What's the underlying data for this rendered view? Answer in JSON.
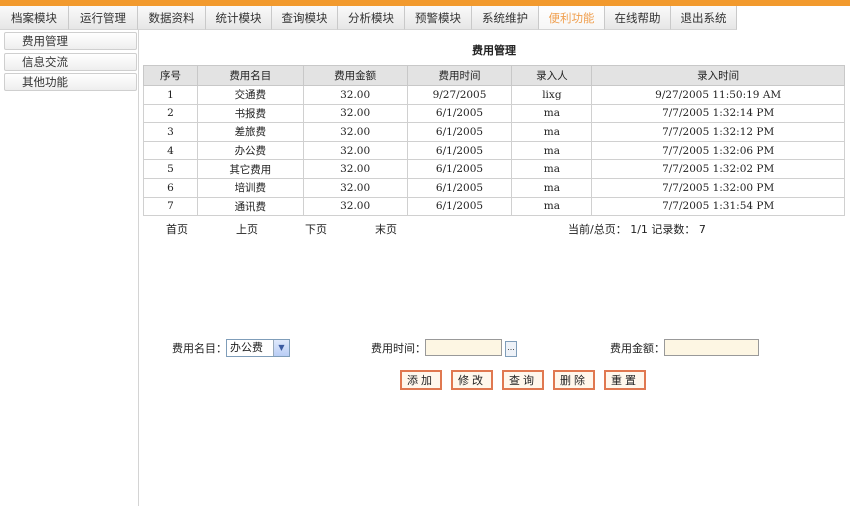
{
  "tabs": [
    "档案模块",
    "运行管理",
    "数据资料",
    "统计模块",
    "查询模块",
    "分析模块",
    "预警模块",
    "系统维护",
    "便利功能",
    "在线帮助",
    "退出系统"
  ],
  "active_tab_index": 8,
  "accent_color": "#f29a2e",
  "sidebar": {
    "items": [
      "费用管理",
      "信息交流",
      "其他功能"
    ]
  },
  "main": {
    "title": "费用管理"
  },
  "table": {
    "headers": [
      "序号",
      "费用名目",
      "费用金额",
      "费用时间",
      "录入人",
      "录入时间"
    ],
    "rows": [
      [
        "1",
        "交通费",
        "32.00",
        "9/27/2005",
        "lixg",
        "9/27/2005 11:50:19 AM"
      ],
      [
        "2",
        "书报费",
        "32.00",
        "6/1/2005",
        "ma",
        "7/7/2005 1:32:14 PM"
      ],
      [
        "3",
        "差旅费",
        "32.00",
        "6/1/2005",
        "ma",
        "7/7/2005 1:32:12 PM"
      ],
      [
        "4",
        "办公费",
        "32.00",
        "6/1/2005",
        "ma",
        "7/7/2005 1:32:06 PM"
      ],
      [
        "5",
        "其它费用",
        "32.00",
        "6/1/2005",
        "ma",
        "7/7/2005 1:32:02 PM"
      ],
      [
        "6",
        "培训费",
        "32.00",
        "6/1/2005",
        "ma",
        "7/7/2005 1:32:00 PM"
      ],
      [
        "7",
        "通讯费",
        "32.00",
        "6/1/2005",
        "ma",
        "7/7/2005 1:31:54 PM"
      ]
    ]
  },
  "pager": {
    "first": "首页",
    "prev": "上页",
    "next": "下页",
    "last": "末页",
    "info": "当前/总页： 1/1 记录数： 7"
  },
  "form": {
    "category_label": "费用名目：",
    "category_value": "办公费",
    "time_label": "费用时间：",
    "time_value": "",
    "date_btn_label": "...",
    "amount_label": "费用金额：",
    "amount_value": "",
    "buttons": [
      "添加",
      "修改",
      "查询",
      "删除",
      "重置"
    ]
  }
}
